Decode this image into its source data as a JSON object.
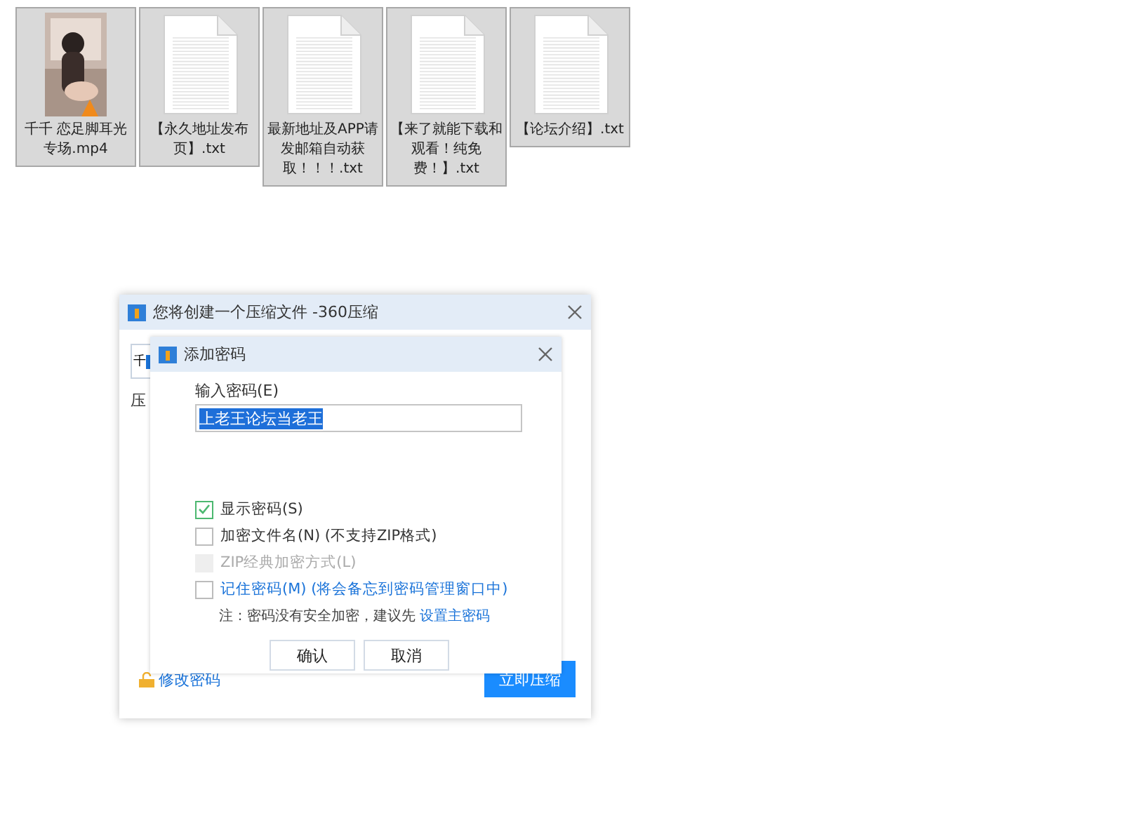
{
  "files": [
    {
      "kind": "video",
      "name": "千千  恋足脚耳光专场.mp4",
      "selected": true
    },
    {
      "kind": "text",
      "name": "【永久地址发布页】.txt",
      "selected": true
    },
    {
      "kind": "text",
      "name": "最新地址及APP请发邮箱自动获取！！！.txt",
      "selected": true
    },
    {
      "kind": "text",
      "name": "【来了就能下载和观看！纯免费！】.txt",
      "selected": true
    },
    {
      "kind": "text",
      "name": "【论坛介绍】.txt",
      "selected": true
    }
  ],
  "main_dialog": {
    "title": "您将创建一个压缩文件 -360压缩",
    "path_value": "千",
    "label": "压",
    "link": "修改密码",
    "primary_button": "立即压缩"
  },
  "password_dialog": {
    "title": "添加密码",
    "field_label": "输入密码(E)",
    "value": "上老王论坛当老王",
    "value_selected": true,
    "options": [
      {
        "kind": "plain",
        "label": "显示密码(S)",
        "checked": true,
        "disabled": false
      },
      {
        "kind": "plain",
        "label": "加密文件名(N) (不支持ZIP格式)",
        "checked": false,
        "disabled": false
      },
      {
        "kind": "plain",
        "label": "ZIP经典加密方式(L)",
        "checked": false,
        "disabled": true
      },
      {
        "kind": "link",
        "label": "记住密码(M) (将会备忘到密码管理窗口中)",
        "checked": false,
        "disabled": false
      }
    ],
    "note": "注：密码没有安全加密，建议先",
    "note_link": "设置主密码",
    "buttons": [
      "确认",
      "取消"
    ]
  }
}
